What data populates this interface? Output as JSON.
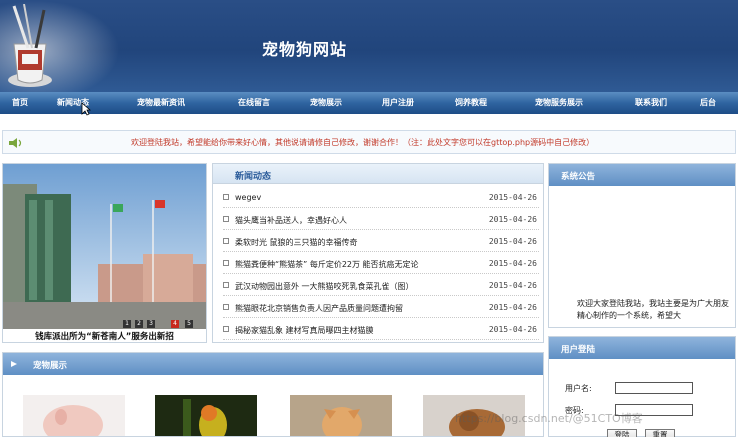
{
  "header": {
    "title": "宠物狗网站"
  },
  "nav": [
    "首页",
    "新闻动态",
    "宠物最新资讯",
    "在线留言",
    "宠物展示",
    "用户注册",
    "饲养教程",
    "宠物服务展示",
    "联系我们",
    "后台"
  ],
  "notice": {
    "icon": "speaker-icon",
    "text": "欢迎登陆我站，希望能给你带来好心情，其他说请请修自己修改，谢谢合作！（注：此处文字您可以在gttop.php源码中自己修改）"
  },
  "banner": {
    "caption": "钱库派出所为“新苍南人”服务出新招",
    "pages": [
      "1",
      "2",
      "3",
      "4",
      "5"
    ]
  },
  "news": {
    "title": "新闻动态",
    "items": [
      {
        "title": "wegev",
        "date": "2015-04-26"
      },
      {
        "title": "猫头鹰当补品送人，幸遇好心人",
        "date": "2015-04-26"
      },
      {
        "title": "柔软时光 鼠狼的三只猫的幸福传奇",
        "date": "2015-04-26"
      },
      {
        "title": "熊猫粪便种“熊猫茶” 每斤定价22万 能否抗癌无定论",
        "date": "2015-04-26"
      },
      {
        "title": "武汉动物园出意外 一大熊猫咬死乳食菜孔雀（图）",
        "date": "2015-04-26"
      },
      {
        "title": "熊猫眼花北京销售负责人因产品质量问题遭拘留",
        "date": "2015-04-26"
      },
      {
        "title": "揭秘家猫乱象 建材写真局曝四主材猫膜",
        "date": "2015-04-26"
      }
    ]
  },
  "sys_notice": {
    "title": "系统公告",
    "text": "欢迎大家登陆我站，我站主要是为广大朋友精心制作的一个系统，希望大"
  },
  "login": {
    "title": "用户登陆",
    "username_label": "用户名:",
    "password_label": "密码:",
    "login_button": "登陆",
    "reset_button": "重置"
  },
  "pets": {
    "title": "宠物展示",
    "items": [
      "pig-photo",
      "parrot-photo",
      "kitten-photo",
      "puppy-photo"
    ]
  },
  "watermark": "https://blog.csdn.net/@51CTO博客"
}
